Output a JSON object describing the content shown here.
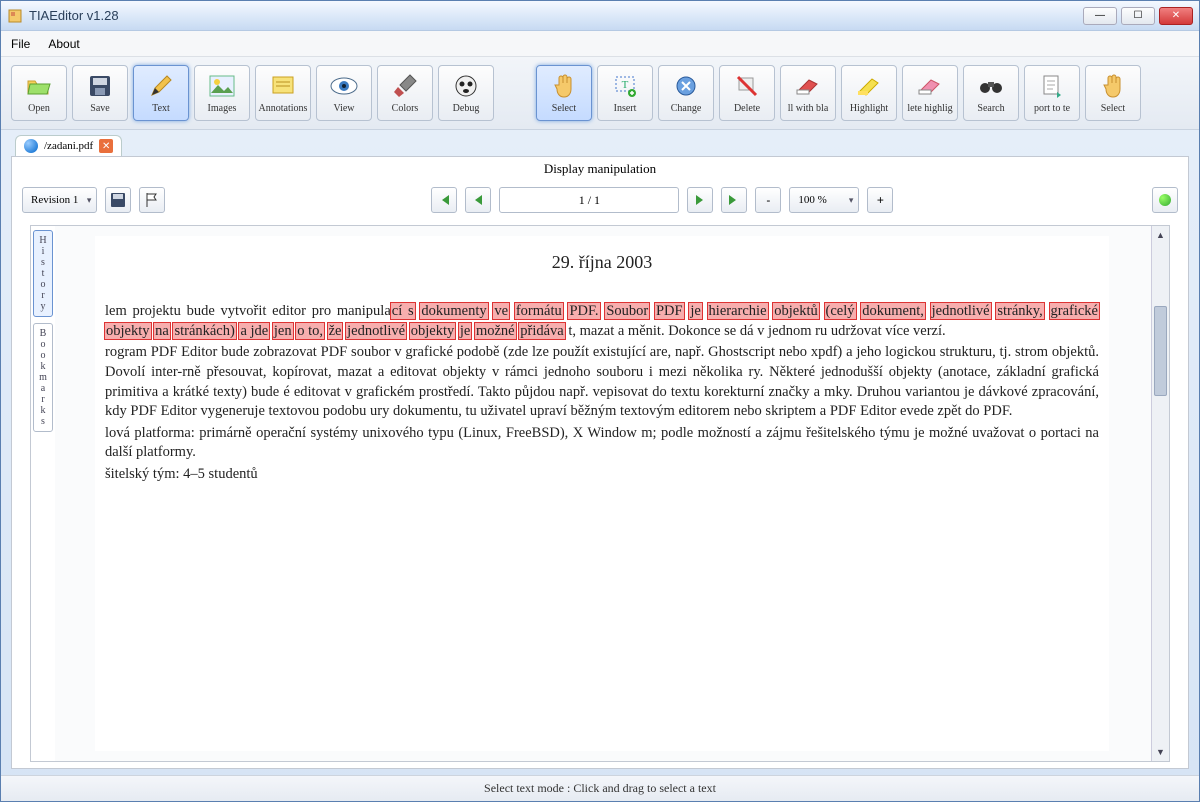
{
  "window": {
    "title": "TIAEditor v1.28"
  },
  "menu": {
    "file": "File",
    "about": "About"
  },
  "toolbar": {
    "open": "Open",
    "save": "Save",
    "text": "Text",
    "images": "Images",
    "annotations": "Annotations",
    "view": "View",
    "colors": "Colors",
    "debug": "Debug",
    "select": "Select",
    "insert": "Insert",
    "change": "Change",
    "delete": "Delete",
    "fillwithblank": "ll with bla",
    "highlight": "Highlight",
    "deletehighlight": "lete highlig",
    "search": "Search",
    "exporttotext": "port to te",
    "select2": "Select"
  },
  "tab": {
    "label": "/zadani.pdf"
  },
  "panel": {
    "title": "Display manipulation"
  },
  "controls": {
    "revision": "Revision 1",
    "page_field": "1 / 1",
    "zoom": "100 %",
    "minus": "-",
    "plus": "+"
  },
  "sidetabs": {
    "history": [
      "H",
      "i",
      "s",
      "t",
      "o",
      "r",
      "y"
    ],
    "bookmarks": [
      "B",
      "o",
      "o",
      "k",
      "m",
      "a",
      "r",
      "k",
      "s"
    ]
  },
  "document": {
    "date": "29. října 2003",
    "para1_pre": "lem projektu bude vytvořit editor pro manipula",
    "para1_hl": [
      "cí s",
      "dokumenty",
      "ve",
      "formátu",
      "PDF.",
      "Soubor",
      "PDF",
      "je",
      "hierarchie",
      "objektů",
      "(celý",
      "dokument,",
      "jednotlivé",
      "stránky,",
      "grafické",
      "objekty",
      "na",
      "stránkách)",
      "a jde",
      "jen",
      "o to,",
      "že",
      "jednotlivé",
      "objekty",
      "je",
      "možné",
      "přidáva"
    ],
    "para1_post": "t, mazat a měnit. Dokonce se dá v jednom ru udržovat více verzí.",
    "para2": "rogram PDF Editor bude zobrazovat PDF soubor v grafické podobě (zde lze použít existující are, např. Ghostscript nebo xpdf) a jeho logickou strukturu, tj. strom objektů. Dovolí inter-rně přesouvat, kopírovat, mazat a editovat objekty v rámci jednoho souboru i mezi několika ry. Některé jednodušší objekty (anotace, základní grafická primitiva a krátké texty) bude é editovat v grafickém prostředí. Takto půjdou např. vepisovat do textu korekturní značky a mky. Druhou variantou je dávkové zpracování, kdy PDF Editor vygeneruje textovou podobu ury dokumentu, tu uživatel upraví běžným textovým editorem nebo skriptem a PDF Editor evede zpět do PDF.",
    "para3": "lová platforma: primárně operační systémy unixového typu (Linux, FreeBSD), X Window m; podle možností a zájmu řešitelského týmu je možné uvažovat o portaci na další platformy.",
    "para4": "šitelský tým: 4–5 studentů"
  },
  "status": {
    "text": "Select text mode : Click and drag to select a text"
  }
}
